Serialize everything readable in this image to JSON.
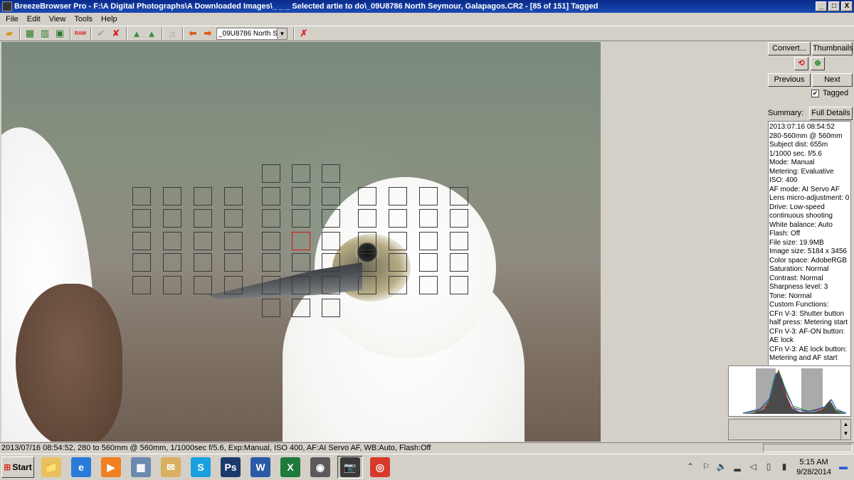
{
  "window": {
    "title": "BreezeBrowser Pro - F:\\A Digital Photographs\\A Downloaded Images\\_ _ _ Selected artie to do\\_09U8786  North Seymour, Galapagos.CR2 - [85 of 151] Tagged",
    "minimize": "_",
    "maximize": "□",
    "close": "X"
  },
  "menu": [
    "File",
    "Edit",
    "View",
    "Tools",
    "Help"
  ],
  "toolbar": {
    "file_select_value": "_09U8786  North S",
    "raw_label": "RAW"
  },
  "side": {
    "convert_label": "Convert...",
    "thumbnails_label": "Thumbnails",
    "previous_label": "Previous",
    "next_label": "Next",
    "tagged_label": "Tagged",
    "tagged_checked": true,
    "summary_label": "Summary:",
    "full_details_label": "Full Details",
    "info_lines": [
      "2013:07:16 08:54:52",
      "280-560mm @ 560mm",
      "Subject dist: 655m",
      "1/1000 sec. f/5.6",
      "Mode: Manual",
      "Metering: Evaluative",
      "ISO: 400",
      "AF mode: AI Servo AF",
      "Lens micro-adjustment: 0",
      "Drive: Low-speed",
      "continuous shooting",
      "White balance: Auto",
      "Flash: Off",
      "File size: 19.9MB",
      "Image size: 5184 x 3456",
      "Color space: AdobeRGB",
      "Saturation: Normal",
      "Contrast: Normal",
      "Sharpness level: 3",
      "Tone: Normal",
      "Custom Functions:",
      "CFn V-3: Shutter button",
      "half press: Metering start",
      "CFn V-3: AF-ON button:",
      "AE lock",
      "CFn V-3: AE lock button:",
      "Metering and AF start"
    ]
  },
  "status": {
    "text": "2013/07/16 08:54:52, 280 to 560mm @ 560mm, 1/1000sec f/5.6, Exp:Manual, ISO 400, AF:AI Servo AF, WB:Auto, Flash:Off"
  },
  "taskbar": {
    "start_label": "Start",
    "apps": [
      {
        "name": "folder-icon",
        "glyph": "📁",
        "bg": "#e8c060"
      },
      {
        "name": "internet-explorer-icon",
        "glyph": "e",
        "bg": "#2a7ad8"
      },
      {
        "name": "media-player-icon",
        "glyph": "▶",
        "bg": "#f08020"
      },
      {
        "name": "calculator-icon",
        "glyph": "▦",
        "bg": "#6a8ab0"
      },
      {
        "name": "mail-icon",
        "glyph": "✉",
        "bg": "#d8b060"
      },
      {
        "name": "skype-icon",
        "glyph": "S",
        "bg": "#1aa0e0"
      },
      {
        "name": "photoshop-icon",
        "glyph": "Ps",
        "bg": "#1a3a6a"
      },
      {
        "name": "word-icon",
        "glyph": "W",
        "bg": "#2a5aa8"
      },
      {
        "name": "excel-icon",
        "glyph": "X",
        "bg": "#1e7a3a"
      },
      {
        "name": "camera-utility-icon",
        "glyph": "◉",
        "bg": "#5a5a5a"
      },
      {
        "name": "camera-icon",
        "glyph": "📷",
        "bg": "#3a3a3a"
      },
      {
        "name": "chrome-icon",
        "glyph": "◎",
        "bg": "#d83a2a"
      }
    ],
    "time": "5:15 AM",
    "date": "9/28/2014"
  },
  "colors": {
    "title_bar": "#0a2a8a",
    "af_active": "#dd1111",
    "chrome": "#d4d0c8"
  }
}
